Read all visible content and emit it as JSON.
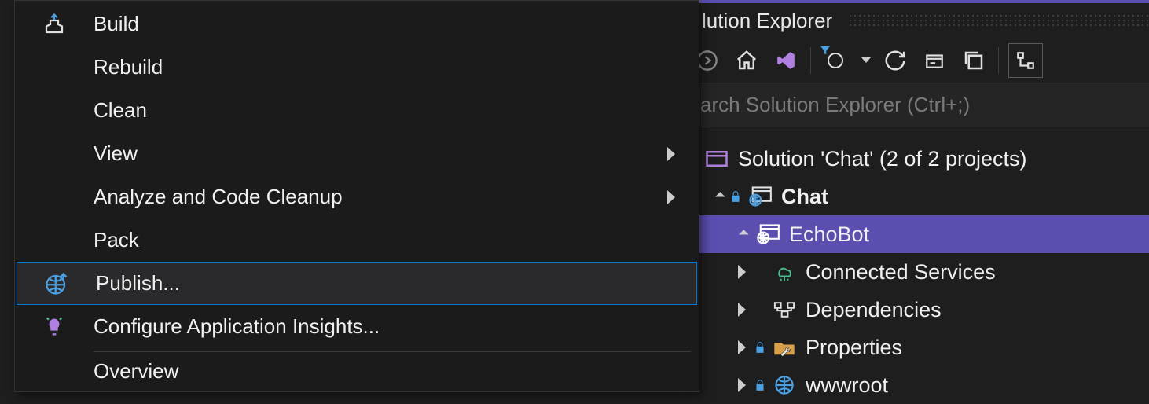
{
  "context_menu": {
    "items": [
      {
        "label": "Build",
        "icon": "build-icon"
      },
      {
        "label": "Rebuild"
      },
      {
        "label": "Clean"
      },
      {
        "label": "View",
        "submenu": true
      },
      {
        "label": "Analyze and Code Cleanup",
        "submenu": true
      },
      {
        "label": "Pack"
      },
      {
        "label": "Publish...",
        "icon": "globe-up-icon",
        "highlight": true
      },
      {
        "label": "Configure Application Insights...",
        "icon": "lightbulb-icon",
        "divider_after": true
      },
      {
        "label": "Overview"
      }
    ]
  },
  "solution_explorer": {
    "title_partial": "lution Explorer",
    "search_placeholder_partial": "arch Solution Explorer (Ctrl+;)",
    "tree": {
      "solution_label": "Solution 'Chat' (2 of 2 projects)",
      "nodes": [
        {
          "label": "Chat",
          "icon": "globe-window-icon",
          "bold": true,
          "locked": true,
          "indent": 1,
          "expanded": true
        },
        {
          "label": "EchoBot",
          "icon": "globe-window-icon",
          "selected": true,
          "indent": 2,
          "expanded": true
        },
        {
          "label": "Connected Services",
          "icon": "cloud-service-icon",
          "indent": 3,
          "expanded": false
        },
        {
          "label": "Dependencies",
          "icon": "dependency-icon",
          "indent": 3,
          "expanded": false
        },
        {
          "label": "Properties",
          "icon": "wrench-folder-icon",
          "locked": true,
          "indent": 3,
          "expanded": false
        },
        {
          "label": "wwwroot",
          "icon": "globe-icon",
          "locked": true,
          "indent": 3,
          "expanded": false
        }
      ]
    }
  }
}
